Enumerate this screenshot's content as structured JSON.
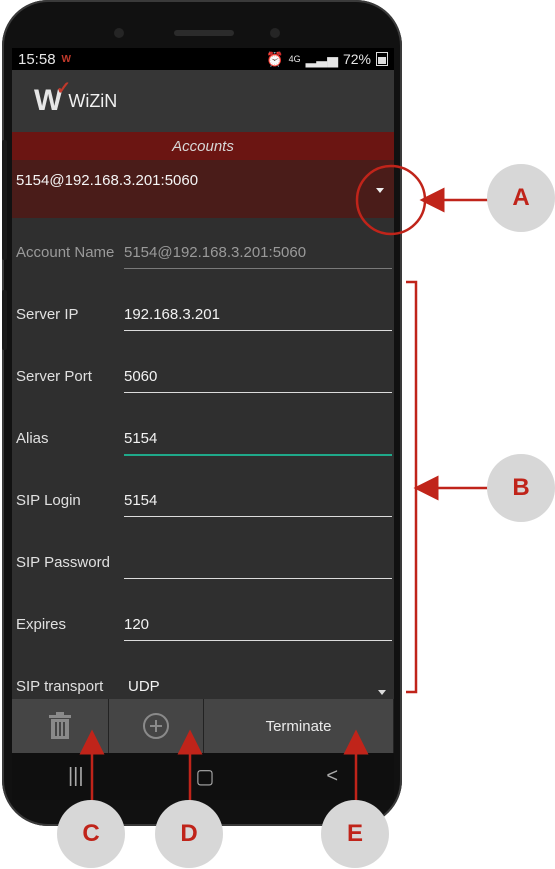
{
  "status": {
    "time": "15:58",
    "network": "4G",
    "battery": "72%"
  },
  "app": {
    "logo_text": "W",
    "name": "WiZiN"
  },
  "accounts": {
    "header": "Accounts",
    "selected": "5154@192.168.3.201:5060"
  },
  "form": [
    {
      "label": "Account Name",
      "value": "5154@192.168.3.201:5060"
    },
    {
      "label": "Server IP",
      "value": "192.168.3.201"
    },
    {
      "label": "Server Port",
      "value": "5060"
    },
    {
      "label": "Alias",
      "value": "5154"
    },
    {
      "label": "SIP Login",
      "value": "5154"
    },
    {
      "label": "SIP Password",
      "value": ""
    },
    {
      "label": "Expires",
      "value": "120"
    },
    {
      "label": "SIP transport",
      "value": "UDP"
    }
  ],
  "toolbar": {
    "delete_icon": "trash-icon",
    "add_icon": "plus-circle-icon",
    "terminate_label": "Terminate"
  },
  "navbar": {
    "recent": "|||",
    "home": "▢",
    "back": "<"
  },
  "callouts": {
    "a": "A",
    "b": "B",
    "c": "C",
    "d": "D",
    "e": "E"
  },
  "colors": {
    "accent": "#c0241a",
    "focus": "#1fa98a",
    "header": "#6b1512"
  }
}
